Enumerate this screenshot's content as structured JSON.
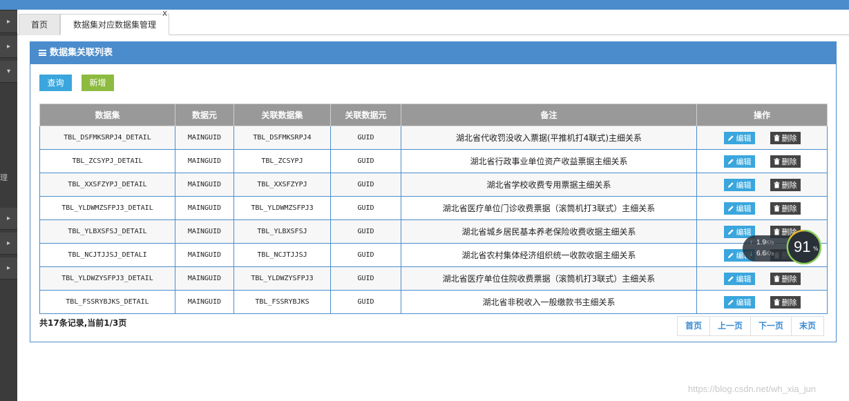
{
  "tabs": {
    "home": "首页",
    "active": "数据集对应数据集管理",
    "close": "X"
  },
  "sidebar": {
    "fragment_text": "理"
  },
  "panel": {
    "title": "数据集关联列表"
  },
  "toolbar": {
    "query_label": "查询",
    "add_label": "新增"
  },
  "table": {
    "headers": [
      "数据集",
      "数据元",
      "关联数据集",
      "关联数据元",
      "备注",
      "操作"
    ],
    "rows": [
      {
        "dataset": "TBL_DSFMKSRPJ4_DETAIL",
        "element": "MAINGUID",
        "rel_dataset": "TBL_DSFMKSRPJ4",
        "rel_element": "GUID",
        "remark": "湖北省代收罚没收入票据(平推机打4联式)主细关系"
      },
      {
        "dataset": "TBL_ZCSYPJ_DETAIL",
        "element": "MAINGUID",
        "rel_dataset": "TBL_ZCSYPJ",
        "rel_element": "GUID",
        "remark": "湖北省行政事业单位资产收益票据主细关系"
      },
      {
        "dataset": "TBL_XXSFZYPJ_DETAIL",
        "element": "MAINGUID",
        "rel_dataset": "TBL_XXSFZYPJ",
        "rel_element": "GUID",
        "remark": "湖北省学校收费专用票据主细关系"
      },
      {
        "dataset": "TBL_YLDWMZSFPJ3_DETAIL",
        "element": "MAINGUID",
        "rel_dataset": "TBL_YLDWMZSFPJ3",
        "rel_element": "GUID",
        "remark": "湖北省医疗单位门诊收费票据（滚筒机打3联式）主细关系"
      },
      {
        "dataset": "TBL_YLBXSFSJ_DETAIL",
        "element": "MAINGUID",
        "rel_dataset": "TBL_YLBXSFSJ",
        "rel_element": "GUID",
        "remark": "湖北省城乡居民基本养老保险收费收据主细关系"
      },
      {
        "dataset": "TBL_NCJTJJSJ_DETALI",
        "element": "MAINGUID",
        "rel_dataset": "TBL_NCJTJJSJ",
        "rel_element": "GUID",
        "remark": "湖北省农村集体经济组织统一收款收据主细关系"
      },
      {
        "dataset": "TBL_YLDWZYSFPJ3_DETAIL",
        "element": "MAINGUID",
        "rel_dataset": "TBL_YLDWZYSFPJ3",
        "rel_element": "GUID",
        "remark": "湖北省医疗单位住院收费票据（滚筒机打3联式）主细关系"
      },
      {
        "dataset": "TBL_FSSRYBJKS_DETAIL",
        "element": "MAINGUID",
        "rel_dataset": "TBL_FSSRYBJKS",
        "rel_element": "GUID",
        "remark": "湖北省非税收入一般缴款书主细关系"
      }
    ],
    "edit_label": "编辑",
    "delete_label": "删除"
  },
  "footer": {
    "summary": "共17条记录,当前1/3页",
    "pager": [
      "首页",
      "上一页",
      "下一页",
      "末页"
    ]
  },
  "speed_widget": {
    "upload": "1.9",
    "download": "6.6",
    "unit": "K/s",
    "percent": "91",
    "percent_sign": "%"
  },
  "watermark": "https://blog.csdn.net/wh_xia_jun",
  "colors": {
    "brand": "#4a8ccc",
    "query": "#3aa6dd",
    "add": "#8dbb3f",
    "header_bg": "#999999",
    "delete": "#444444"
  }
}
